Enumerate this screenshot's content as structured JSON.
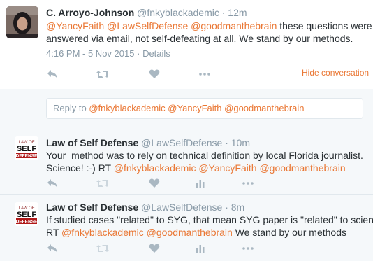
{
  "main_tweet": {
    "name": "C. Arroyo-Johnson",
    "handle": "@fnkyblackademic",
    "time": "· 12m",
    "body": {
      "m1": "@YancyFaith",
      "m2": "@LawSelfDefense",
      "m3": "@goodmanthebrain",
      "text1": "these questions were",
      "text2": "answered via email, not self-defeating at all. We stand by our methods."
    },
    "date": "4:16 PM - 5 Nov 2015",
    "sep": "·",
    "details": "Details",
    "hide_conversation": "Hide conversation",
    "icons": [
      "reply-icon",
      "retweet-icon",
      "like-icon",
      "more-icon"
    ]
  },
  "reply_box": {
    "prefix": "Reply to",
    "m1": "@fnkyblackademic",
    "m2": "@YancyFaith",
    "m3": "@goodmanthebrain"
  },
  "replies": [
    {
      "name": "Law of Self Defense",
      "handle": "@LawSelfDefense",
      "time": "· 10m",
      "line1": "Your  method was to rely on technical definition by local Florida journalist.",
      "line2_text": "Science! :-) RT",
      "m1": "@fnkyblackademic",
      "m2": "@YancyFaith",
      "m3": "@goodmanthebrain",
      "avatar_words": [
        "LAW OF",
        "SELF",
        "DEFENSE"
      ]
    },
    {
      "name": "Law of Self Defense",
      "handle": "@LawSelfDefense",
      "time": "· 8m",
      "line1": "If studied cases \"related\" to SYG, that mean SYG paper is \"related\" to science?",
      "line2_prefix": "RT",
      "m1": "@fnkyblackademic",
      "m2": "@goodmanthebrain",
      "line2_suffix": "We stand by our methods",
      "avatar_words": [
        "LAW OF",
        "SELF",
        "DEFENSE"
      ]
    }
  ],
  "colors": {
    "accent": "#ea7734",
    "text": "#292f33",
    "muted": "#8899a6",
    "icon": "#aab8c2",
    "reply_bg": "#f5f8fa",
    "border": "#e1e8ed"
  }
}
